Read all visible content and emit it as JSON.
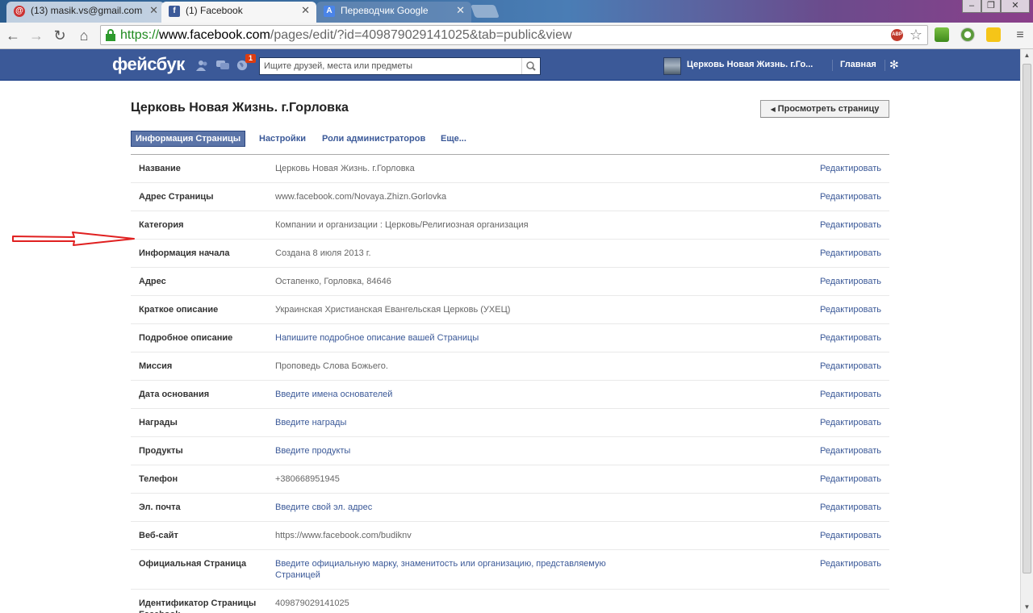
{
  "browser": {
    "tabs": [
      {
        "title": "(13) masik.vs@gmail.com",
        "favicon": "gmail-icon",
        "active": false
      },
      {
        "title": "(1) Facebook",
        "favicon": "facebook-icon",
        "active": true
      },
      {
        "title": "Переводчик Google",
        "favicon": "google-translate-icon",
        "active": false
      }
    ],
    "url": {
      "scheme": "https://",
      "host": "www.facebook.com",
      "path": "/pages/edit/?id=409879029141025&tab=public&view"
    },
    "adblock_label": "ABP"
  },
  "fb_header": {
    "logo": "фейсбук",
    "notification_count": "1",
    "search_placeholder": "Ищите друзей, места или предметы",
    "page_name": "Церковь Новая Жизнь. г.Го...",
    "home": "Главная"
  },
  "page": {
    "title": "Церковь Новая Жизнь. г.Горловка",
    "view_button": "Просмотреть страницу",
    "tabs": [
      {
        "label": "Информация Страницы",
        "selected": true
      },
      {
        "label": "Настройки",
        "selected": false
      },
      {
        "label": "Роли администраторов",
        "selected": false
      },
      {
        "label": "Еще...",
        "selected": false
      }
    ],
    "rows": [
      {
        "label": "Название",
        "value": "Церковь Новая Жизнь. г.Горловка",
        "prompt": false,
        "edit": "Редактировать"
      },
      {
        "label": "Адрес Страницы",
        "value": "www.facebook.com/Novaya.Zhizn.Gorlovka",
        "prompt": false,
        "edit": "Редактировать"
      },
      {
        "label": "Категория",
        "value": "Компании и организации : Церковь/Религиозная организация",
        "prompt": false,
        "edit": "Редактировать"
      },
      {
        "label": "Информация начала",
        "value": "Создана 8 июля 2013 г.",
        "prompt": false,
        "edit": "Редактировать"
      },
      {
        "label": "Адрес",
        "value": "Остапенко, Горловка, 84646",
        "prompt": false,
        "edit": "Редактировать"
      },
      {
        "label": "Краткое описание",
        "value": "Украинская Христианская Евангельская Церковь (УХЕЦ)",
        "prompt": false,
        "edit": "Редактировать"
      },
      {
        "label": "Подробное описание",
        "value": "Напишите подробное описание вашей Страницы",
        "prompt": true,
        "edit": "Редактировать"
      },
      {
        "label": "Миссия",
        "value": "Проповедь Слова Божьего.",
        "prompt": false,
        "edit": "Редактировать"
      },
      {
        "label": "Дата основания",
        "value": "Введите имена основателей",
        "prompt": true,
        "edit": "Редактировать"
      },
      {
        "label": "Награды",
        "value": "Введите награды",
        "prompt": true,
        "edit": "Редактировать"
      },
      {
        "label": "Продукты",
        "value": "Введите продукты",
        "prompt": true,
        "edit": "Редактировать"
      },
      {
        "label": "Телефон",
        "value": "+380668951945",
        "prompt": false,
        "edit": "Редактировать"
      },
      {
        "label": "Эл. почта",
        "value": "Введите свой эл. адрес",
        "prompt": true,
        "edit": "Редактировать"
      },
      {
        "label": "Веб-сайт",
        "value": "https://www.facebook.com/budiknv",
        "prompt": false,
        "edit": "Редактировать"
      },
      {
        "label": "Официальная Страница",
        "value": "Введите официальную марку, знаменитость или организацию, представляемую Страницей",
        "prompt": true,
        "edit": "Редактировать"
      },
      {
        "label": "Идентификатор Страницы Facebook",
        "value": "409879029141025",
        "prompt": false,
        "edit": ""
      }
    ]
  },
  "colors": {
    "fb_blue": "#3b5998",
    "link": "#3b5998",
    "annotation": "#e02020"
  }
}
